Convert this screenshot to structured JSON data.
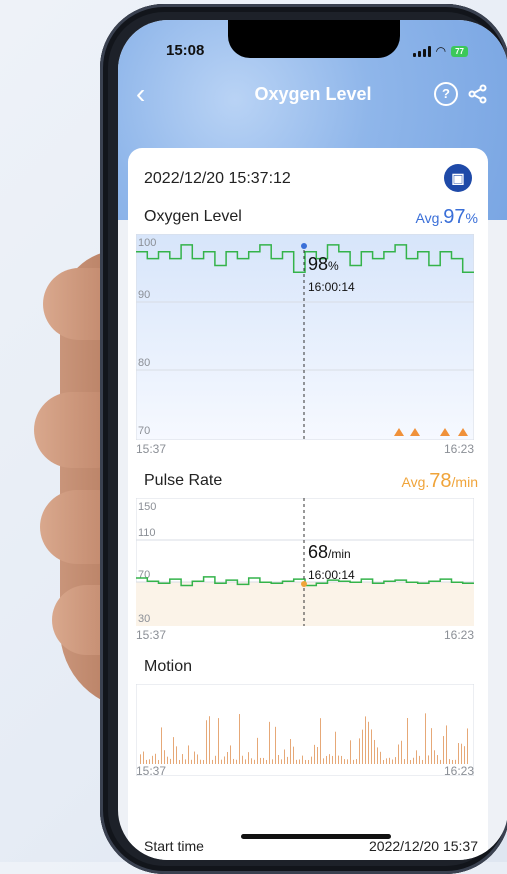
{
  "status_bar": {
    "time": "15:08",
    "battery": "77"
  },
  "nav": {
    "title": "Oxygen Level",
    "help_label": "?"
  },
  "record": {
    "datetime": "2022/12/20 15:37:12"
  },
  "oxygen": {
    "title": "Oxygen Level",
    "avg_prefix": "Avg.",
    "avg_value": "97",
    "avg_unit": "%",
    "cursor_value": "98",
    "cursor_unit": "%",
    "cursor_time": "16:00:14",
    "start_time": "15:37",
    "end_time": "16:23",
    "y_ticks": [
      "100",
      "90",
      "80",
      "70"
    ],
    "color": "#34b34a",
    "accent": "#3a6fd8",
    "alert_color": "#f0913a"
  },
  "pulse": {
    "title": "Pulse Rate",
    "avg_prefix": "Avg.",
    "avg_value": "78",
    "avg_unit": "/min",
    "cursor_value": "68",
    "cursor_unit": "/min",
    "cursor_time": "16:00:14",
    "start_time": "15:37",
    "end_time": "16:23",
    "y_ticks": [
      "150",
      "110",
      "70",
      "30"
    ],
    "color": "#34b34a",
    "accent": "#f0a43a"
  },
  "motion": {
    "title": "Motion",
    "start_time": "15:37",
    "end_time": "16:23",
    "color": "#e6a877"
  },
  "summary": {
    "start_label": "Start time",
    "start_value": "2022/12/20 15:37"
  },
  "chart_data": [
    {
      "type": "line",
      "title": "Oxygen Level",
      "x": [
        "15:37",
        "16:23"
      ],
      "ylim": [
        70,
        100
      ],
      "series": [
        {
          "values": [
            98,
            97,
            98,
            97,
            99,
            97,
            98,
            96,
            98,
            97,
            98,
            99,
            97,
            98,
            95,
            98,
            97,
            99,
            98,
            96,
            98,
            97,
            98,
            99,
            97,
            98,
            96,
            98,
            97,
            95
          ]
        }
      ],
      "annotations": [
        {
          "x": "16:00:14",
          "y": 98
        }
      ]
    },
    {
      "type": "line",
      "title": "Pulse Rate",
      "x": [
        "15:37",
        "16:23"
      ],
      "ylim": [
        30,
        150
      ],
      "series": [
        {
          "values": [
            75,
            72,
            70,
            74,
            68,
            72,
            76,
            70,
            73,
            69,
            75,
            71,
            70,
            72,
            74,
            68,
            70,
            73,
            72,
            71,
            74,
            70,
            72,
            73,
            71,
            70,
            72,
            74,
            71,
            70
          ]
        }
      ],
      "annotations": [
        {
          "x": "16:00:14",
          "y": 68
        }
      ]
    },
    {
      "type": "bar",
      "title": "Motion",
      "x": [
        "15:37",
        "16:23"
      ]
    }
  ]
}
